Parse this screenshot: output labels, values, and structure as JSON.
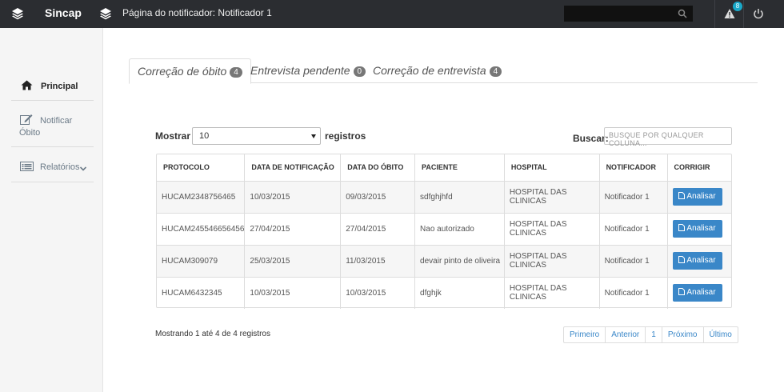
{
  "topbar": {
    "brand": "Sincap",
    "page_title": "Página do notificador: Notificador 1",
    "alert_count": "8"
  },
  "sidebar": {
    "items": [
      {
        "label": "Principal"
      },
      {
        "label1": "Notificar",
        "label2": "Óbito"
      },
      {
        "label": "Relatórios"
      }
    ]
  },
  "tabs": [
    {
      "label": "Correção de óbito",
      "count": "4"
    },
    {
      "label": "Entrevista pendente",
      "count": "0"
    },
    {
      "label": "Correção de entrevista",
      "count": "4"
    }
  ],
  "controls": {
    "show_label": "Mostrar",
    "show_value": "10",
    "show_suffix": "registros",
    "search_label": "Buscar:",
    "search_placeholder": "BUSQUE POR QUALQUER COLUNA..."
  },
  "table": {
    "headers": [
      "PROTOCOLO",
      "DATA DE NOTIFICAÇÃO",
      "DATA DO ÓBITO",
      "PACIENTE",
      "HOSPITAL",
      "NOTIFICADOR",
      "CORRIGIR"
    ],
    "rows": [
      {
        "protocolo": "HUCAM2348756465",
        "data_notificacao": "10/03/2015",
        "data_obito": "09/03/2015",
        "paciente": "sdfghjhfd",
        "hospital": "HOSPITAL DAS CLINICAS",
        "notificador": "Notificador 1",
        "acao": "Analisar"
      },
      {
        "protocolo": "HUCAM245546656456",
        "data_notificacao": "27/04/2015",
        "data_obito": "27/04/2015",
        "paciente": "Nao autorizado",
        "hospital": "HOSPITAL DAS CLINICAS",
        "notificador": "Notificador 1",
        "acao": "Analisar"
      },
      {
        "protocolo": "HUCAM309079",
        "data_notificacao": "25/03/2015",
        "data_obito": "11/03/2015",
        "paciente": "devair pinto de oliveira",
        "hospital": "HOSPITAL DAS CLINICAS",
        "notificador": "Notificador 1",
        "acao": "Analisar"
      },
      {
        "protocolo": "HUCAM6432345",
        "data_notificacao": "10/03/2015",
        "data_obito": "10/03/2015",
        "paciente": "dfghjk",
        "hospital": "HOSPITAL DAS CLINICAS",
        "notificador": "Notificador 1",
        "acao": "Analisar"
      }
    ]
  },
  "footer": {
    "info": "Mostrando 1 até 4 de 4 registros",
    "pager": [
      "Primeiro",
      "Anterior",
      "1",
      "Próximo",
      "Último"
    ]
  },
  "colors": {
    "topbar": "#2b2d31",
    "primary_button": "#3a87c8",
    "badge": "#19a9c9"
  }
}
